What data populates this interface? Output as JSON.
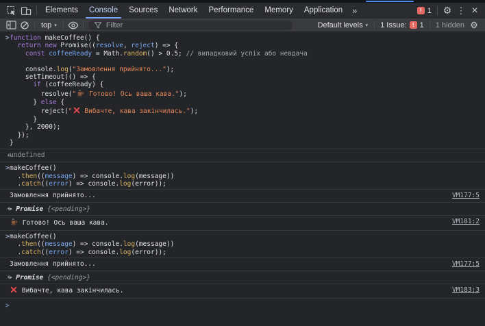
{
  "colors": {
    "accent": "#73a6f5",
    "error_red": "#e5484d",
    "badge_red": "#e46962",
    "bg_console": "#242528",
    "bg_tabbar": "#2b2c2f",
    "bg_toolbar": "#3a3b3e",
    "kw": "#a87fdd",
    "fn": "#d9b45f",
    "vr": "#76a9f5",
    "str": "#e8895a",
    "dim": "#9aa0a6"
  },
  "glyphs": {
    "gear": "⚙",
    "kebab": "⋮",
    "close": "×",
    "caret": "▾",
    "more_tabs": "»",
    "badge_mark": "!",
    "chevron": ">"
  },
  "tabbar": {
    "tabs": [
      "Elements",
      "Console",
      "Sources",
      "Network",
      "Performance",
      "Memory",
      "Application"
    ],
    "active_tab": "Console",
    "error_count": "1"
  },
  "toolbar": {
    "context": "top",
    "filter_placeholder": "Filter",
    "levels": "Default levels",
    "issues_label": "1 Issue:",
    "issues_count": "1",
    "hidden_label": "1 hidden"
  },
  "console": {
    "entries": [
      {
        "kind": "input",
        "lines": [
          [
            [
              "k",
              "function"
            ],
            [
              "p",
              " makeCoffee() {"
            ]
          ],
          [
            [
              "p",
              "  "
            ],
            [
              "k",
              "return"
            ],
            [
              "p",
              " "
            ],
            [
              "k",
              "new"
            ],
            [
              "p",
              " Promise(("
            ],
            [
              "v",
              "resolve"
            ],
            [
              "p",
              ", "
            ],
            [
              "v",
              "reject"
            ],
            [
              "p",
              ") => {"
            ]
          ],
          [
            [
              "p",
              "    "
            ],
            [
              "k",
              "const"
            ],
            [
              "p",
              " "
            ],
            [
              "v",
              "coffeeReady"
            ],
            [
              "p",
              " = Math."
            ],
            [
              "f",
              "random"
            ],
            [
              "p",
              "() > "
            ],
            [
              "n",
              "0.5"
            ],
            [
              "p",
              "; "
            ],
            [
              "c",
              "// випадковий успіх або невдача"
            ]
          ],
          [],
          [
            [
              "p",
              "    console."
            ],
            [
              "f",
              "log"
            ],
            [
              "p",
              "("
            ],
            [
              "s",
              "\"Замовлення прийнято...\""
            ],
            [
              "p",
              ");"
            ]
          ],
          [
            [
              "p",
              "    setTimeout(() => {"
            ]
          ],
          [
            [
              "p",
              "      "
            ],
            [
              "k",
              "if"
            ],
            [
              "p",
              " (coffeeReady) {"
            ]
          ],
          [
            [
              "p",
              "        resolve("
            ],
            [
              "s",
              "\""
            ],
            [
              "i",
              "coffee"
            ],
            [
              "s",
              " Готово! Ось ваша кава.\""
            ],
            [
              "p",
              ");"
            ]
          ],
          [
            [
              "p",
              "      } "
            ],
            [
              "k",
              "else"
            ],
            [
              "p",
              " {"
            ]
          ],
          [
            [
              "p",
              "        reject("
            ],
            [
              "s",
              "\""
            ],
            [
              "i",
              "xmark"
            ],
            [
              "s",
              " Вибачте, кава закінчилась.\""
            ],
            [
              "p",
              ");"
            ]
          ],
          [
            [
              "p",
              "      }"
            ]
          ],
          [
            [
              "p",
              "    }, "
            ],
            [
              "n",
              "2000"
            ],
            [
              "p",
              ");"
            ]
          ],
          [
            [
              "p",
              "  });"
            ]
          ],
          [
            [
              "p",
              "}"
            ]
          ]
        ]
      },
      {
        "kind": "result",
        "tokens": [
          [
            "d",
            "undefined"
          ]
        ]
      },
      {
        "kind": "input",
        "lines": [
          [
            [
              "p",
              "makeCoffee()"
            ]
          ],
          [
            [
              "p",
              "  ."
            ],
            [
              "f",
              "then"
            ],
            [
              "p",
              "(("
            ],
            [
              "v",
              "message"
            ],
            [
              "p",
              ") => console."
            ],
            [
              "f",
              "log"
            ],
            [
              "p",
              "(message))"
            ]
          ],
          [
            [
              "p",
              "  ."
            ],
            [
              "f",
              "catch"
            ],
            [
              "p",
              "(("
            ],
            [
              "v",
              "error"
            ],
            [
              "p",
              ") => console."
            ],
            [
              "f",
              "log"
            ],
            [
              "p",
              "(error));"
            ]
          ]
        ]
      },
      {
        "kind": "log",
        "tokens": [
          [
            "p",
            "Замовлення прийнято..."
          ]
        ],
        "link": "VM177:5"
      },
      {
        "kind": "promise",
        "obj": "Promise",
        "preview": "{<pending>}"
      },
      {
        "kind": "log",
        "tokens": [
          [
            "i",
            "coffee"
          ],
          [
            "p",
            " Готово! Ось ваша кава."
          ]
        ],
        "link": "VM181:2"
      },
      {
        "kind": "input",
        "lines": [
          [
            [
              "p",
              "makeCoffee()"
            ]
          ],
          [
            [
              "p",
              "  ."
            ],
            [
              "f",
              "then"
            ],
            [
              "p",
              "(("
            ],
            [
              "v",
              "message"
            ],
            [
              "p",
              ") => console."
            ],
            [
              "f",
              "log"
            ],
            [
              "p",
              "(message))"
            ]
          ],
          [
            [
              "p",
              "  ."
            ],
            [
              "f",
              "catch"
            ],
            [
              "p",
              "(("
            ],
            [
              "v",
              "error"
            ],
            [
              "p",
              ") => console."
            ],
            [
              "f",
              "log"
            ],
            [
              "p",
              "(error));"
            ]
          ]
        ]
      },
      {
        "kind": "log",
        "tokens": [
          [
            "p",
            "Замовлення прийнято..."
          ]
        ],
        "link": "VM177:5"
      },
      {
        "kind": "promise",
        "obj": "Promise",
        "preview": "{<pending>}"
      },
      {
        "kind": "log",
        "tokens": [
          [
            "i",
            "xmark"
          ],
          [
            "p",
            " Вибачте, кава закінчилась."
          ]
        ],
        "link": "VM183:3"
      },
      {
        "kind": "prompt"
      }
    ]
  }
}
